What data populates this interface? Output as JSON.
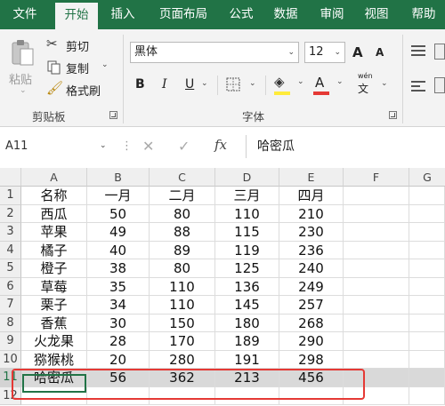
{
  "tabs": [
    "文件",
    "开始",
    "插入",
    "页面布局",
    "公式",
    "数据",
    "审阅",
    "视图",
    "帮助"
  ],
  "ribbon": {
    "paste_label": "粘贴",
    "cut_label": "剪切",
    "copy_label": "复制",
    "format_painter_label": "格式刷",
    "clipboard_group": "剪贴板",
    "font_group": "字体",
    "font_name": "黑体",
    "font_size": "12",
    "bold": "B",
    "italic": "I",
    "underline": "U",
    "grow_font": "A",
    "shrink_font": "A",
    "font_color": "A",
    "phonetic": "wén"
  },
  "formula_bar": {
    "name_box": "A11",
    "fx": "fx",
    "value": "哈密瓜"
  },
  "columns": [
    "A",
    "B",
    "C",
    "D",
    "E",
    "F",
    "G"
  ],
  "rows": [
    {
      "num": "1",
      "cells": [
        "名称",
        "一月",
        "二月",
        "三月",
        "四月"
      ]
    },
    {
      "num": "2",
      "cells": [
        "西瓜",
        "50",
        "80",
        "110",
        "210"
      ]
    },
    {
      "num": "3",
      "cells": [
        "苹果",
        "49",
        "88",
        "115",
        "230"
      ]
    },
    {
      "num": "4",
      "cells": [
        "橘子",
        "40",
        "89",
        "119",
        "236"
      ]
    },
    {
      "num": "5",
      "cells": [
        "橙子",
        "38",
        "80",
        "125",
        "240"
      ]
    },
    {
      "num": "6",
      "cells": [
        "草莓",
        "35",
        "110",
        "136",
        "249"
      ]
    },
    {
      "num": "7",
      "cells": [
        "栗子",
        "34",
        "110",
        "145",
        "257"
      ]
    },
    {
      "num": "8",
      "cells": [
        "香蕉",
        "30",
        "150",
        "180",
        "268"
      ]
    },
    {
      "num": "9",
      "cells": [
        "火龙果",
        "28",
        "170",
        "189",
        "290"
      ]
    },
    {
      "num": "10",
      "cells": [
        "猕猴桃",
        "20",
        "280",
        "191",
        "298"
      ]
    },
    {
      "num": "11",
      "cells": [
        "哈密瓜",
        "56",
        "362",
        "213",
        "456"
      ]
    },
    {
      "num": "12",
      "cells": [
        "",
        "",
        "",
        "",
        ""
      ]
    }
  ],
  "colors": {
    "accent": "#217346",
    "highlight_box": "#e53935",
    "selected_row": "#d9d9d9"
  }
}
